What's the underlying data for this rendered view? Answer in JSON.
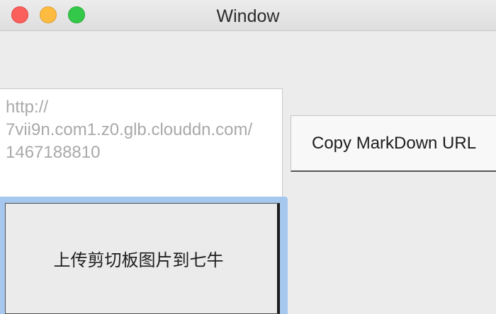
{
  "window": {
    "title": "Window"
  },
  "url_field": {
    "value": "http://\n7vii9n.com1.z0.glb.clouddn.com/\n1467188810"
  },
  "buttons": {
    "copy_markdown_label": "Copy MarkDown URL",
    "upload_label": "上传剪切板图片到七牛"
  },
  "icons": {
    "close": "close-traffic-light",
    "minimize": "minimize-traffic-light",
    "maximize": "zoom-traffic-light"
  },
  "colors": {
    "close": "#fc605c",
    "minimize": "#fdbc40",
    "maximize": "#34c84a",
    "focus_ring": "#a6c8ee"
  }
}
